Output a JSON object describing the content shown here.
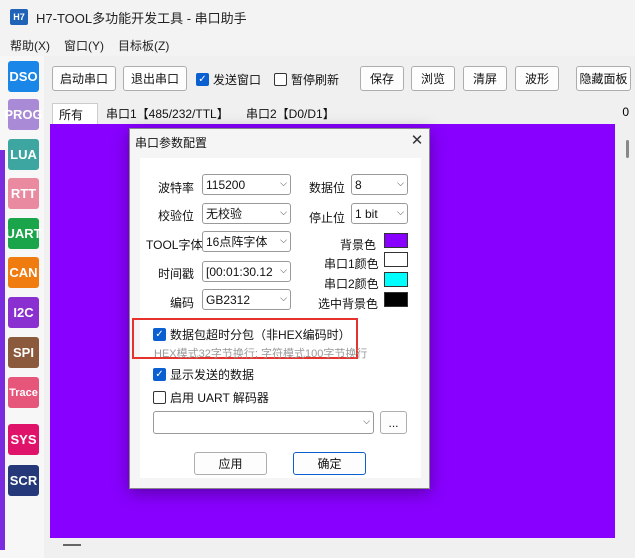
{
  "window": {
    "logo_text": "H7",
    "title": "H7-TOOL多功能开发工具 - 串口助手"
  },
  "menu": [
    "帮助(X)",
    "窗口(Y)",
    "目标板(Z)"
  ],
  "sidebar": [
    {
      "label": "DSO",
      "color": "#1a86e8"
    },
    {
      "label": "PROG",
      "color": "#a98ad6"
    },
    {
      "label": "LUA",
      "color": "#3ea6a0"
    },
    {
      "label": "RTT",
      "color": "#e98aa0"
    },
    {
      "label": "UART",
      "color": "#1aa54a"
    },
    {
      "label": "CAN",
      "color": "#f07c10"
    },
    {
      "label": "I2C",
      "color": "#8a2fd0"
    },
    {
      "label": "SPI",
      "color": "#8b5a3c"
    },
    {
      "label": "Trace",
      "color": "#e5567a"
    },
    {
      "label": "SYS",
      "color": "#e0136b"
    },
    {
      "label": "SCR",
      "color": "#24387a"
    }
  ],
  "toolbar": {
    "start": "启动串口",
    "exit": "退出串口",
    "send_window": "发送窗口",
    "send_window_checked": true,
    "pause_refresh": "暂停刷新",
    "pause_refresh_checked": false,
    "save": "保存",
    "browse": "浏览",
    "clear": "清屏",
    "wave": "波形",
    "hide_panel": "隐藏面板"
  },
  "tabs": {
    "items": [
      "所有",
      "串口1【485/232/TTL】",
      "串口2【D0/D1】"
    ],
    "active": 0,
    "right_value": "0"
  },
  "dialog": {
    "title": "串口参数配置",
    "close": "✕",
    "baud_label": "波特率",
    "baud_value": "115200",
    "databits_label": "数据位",
    "databits_value": "8",
    "parity_label": "校验位",
    "parity_value": "无校验",
    "stopbits_label": "停止位",
    "stopbits_value": "1 bit",
    "font_label": "TOOL字体",
    "font_value": "16点阵字体",
    "timestamp_label": "时间戳",
    "timestamp_value": "[00:01:30.12",
    "encoding_label": "编码",
    "encoding_value": "GB2312",
    "bg_color_label": "背景色",
    "bg_color": "#8800ff",
    "port1_color_label": "串口1颜色",
    "port1_color": "#ffffff",
    "port2_color_label": "串口2颜色",
    "port2_color": "#00ffff",
    "sel_bg_color_label": "选中背景色",
    "sel_bg_color": "#000000",
    "split_packet_label": "数据包超时分包（非HEX编码时）",
    "split_packet_checked": true,
    "split_hint": "HEX模式32字节换行; 字符模式100字节换行",
    "show_sent_label": "显示发送的数据",
    "show_sent_checked": true,
    "uart_decoder_label": "启用 UART 解码器",
    "uart_decoder_checked": false,
    "decoder_value": "",
    "browse_btn": "...",
    "apply": "应用",
    "ok": "确定"
  },
  "colors": {
    "canvas": "#8800ff",
    "highlight": "#e5322d",
    "accent": "#0a5fd1"
  }
}
